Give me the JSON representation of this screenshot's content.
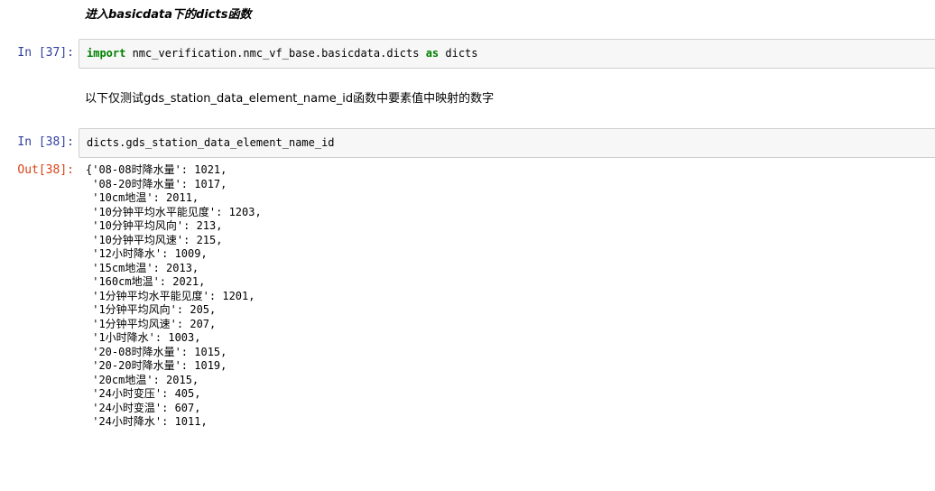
{
  "cells": {
    "md_heading": "进入basicdata下的dicts函数",
    "cell37": {
      "prompt": "In  [37]:",
      "kw_import": "import",
      "module": " nmc_verification.nmc_vf_base.basicdata.dicts ",
      "kw_as": "as",
      "alias": " dicts"
    },
    "md_text": "以下仅测试gds_station_data_element_name_id函数中要素值中映射的数字",
    "cell38": {
      "prompt": "In  [38]:",
      "code": "dicts.gds_station_data_element_name_id",
      "out_prompt": "Out[38]:",
      "output_lines": [
        "{'08-08时降水量': 1021,",
        " '08-20时降水量': 1017,",
        " '10cm地温': 2011,",
        " '10分钟平均水平能见度': 1203,",
        " '10分钟平均风向': 213,",
        " '10分钟平均风速': 215,",
        " '12小时降水': 1009,",
        " '15cm地温': 2013,",
        " '160cm地温': 2021,",
        " '1分钟平均水平能见度': 1201,",
        " '1分钟平均风向': 205,",
        " '1分钟平均风速': 207,",
        " '1小时降水': 1003,",
        " '20-08时降水量': 1015,",
        " '20-20时降水量': 1019,",
        " '20cm地温': 2015,",
        " '24小时变压': 405,",
        " '24小时变温': 607,",
        " '24小时降水': 1011,"
      ]
    }
  }
}
